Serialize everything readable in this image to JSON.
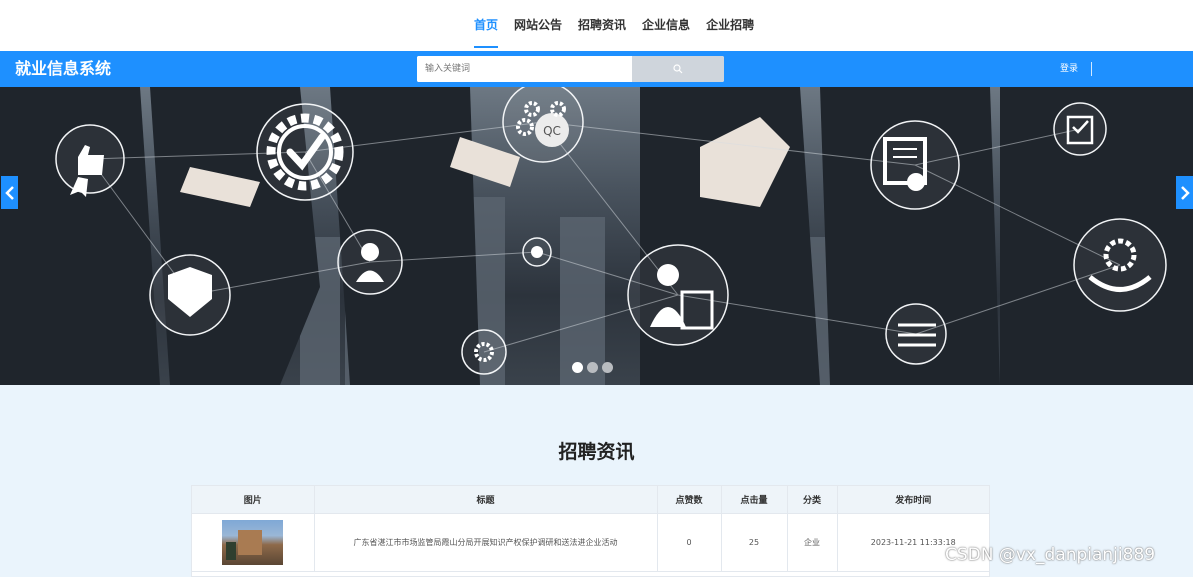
{
  "nav": {
    "items": [
      "首页",
      "网站公告",
      "招聘资讯",
      "企业信息",
      "企业招聘"
    ],
    "active_index": 0
  },
  "header": {
    "title": "就业信息系统",
    "search_placeholder": "输入关键词",
    "login": "登录"
  },
  "banner": {
    "slide_count": 3,
    "active_slide": 0,
    "icon_badges": [
      "QC"
    ]
  },
  "section": {
    "title": "招聘资讯"
  },
  "table": {
    "headers": [
      "图片",
      "标题",
      "点赞数",
      "点击量",
      "分类",
      "发布时间"
    ],
    "rows": [
      {
        "title": "广东省湛江市市场监管局霞山分局开展知识产权保护调研和送法进企业活动",
        "likes": "0",
        "clicks": "25",
        "category": "企业",
        "published": "2023-11-21 11:33:18"
      }
    ]
  },
  "watermark": "CSDN @vx_danpianji889",
  "colors": {
    "primary": "#1e90ff",
    "background": "#eaf4fc"
  }
}
